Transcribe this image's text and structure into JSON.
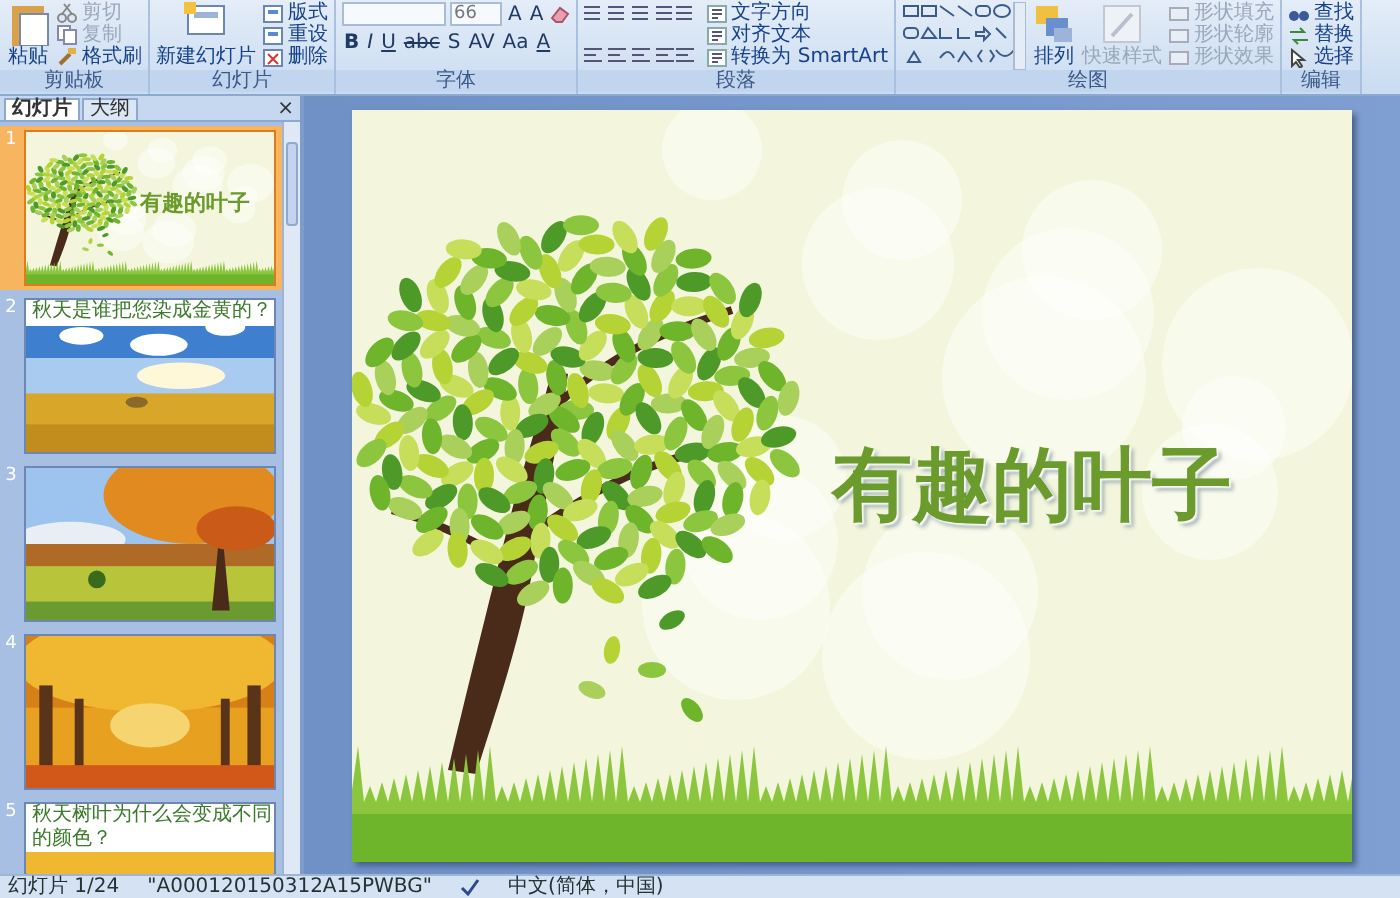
{
  "ribbon": {
    "groups": [
      {
        "label": "剪贴板",
        "controls": [
          {
            "kind": "large",
            "label": "粘贴",
            "disabled": false
          },
          {
            "kind": "small",
            "label": "剪切",
            "disabled": true
          },
          {
            "kind": "small",
            "label": "复制",
            "disabled": true
          },
          {
            "kind": "small",
            "label": "格式刷",
            "disabled": false
          }
        ]
      },
      {
        "label": "幻灯片",
        "controls": [
          {
            "kind": "large",
            "label": "新建幻灯片",
            "disabled": false
          },
          {
            "kind": "small",
            "label": "版式",
            "disabled": false
          },
          {
            "kind": "small",
            "label": "重设",
            "disabled": false
          },
          {
            "kind": "small",
            "label": "删除",
            "disabled": false
          }
        ]
      },
      {
        "label": "字体",
        "font_size": "66",
        "font_buttons": [
          "A",
          "A",
          "B",
          "I",
          "U",
          "abc",
          "S",
          "AV",
          "Aa",
          "A"
        ]
      },
      {
        "label": "段落",
        "controls": [
          {
            "kind": "small",
            "label": "文字方向",
            "disabled": false
          },
          {
            "kind": "small",
            "label": "对齐文本",
            "disabled": false
          },
          {
            "kind": "small",
            "label": "转换为 SmartArt",
            "disabled": false
          }
        ]
      },
      {
        "label": "绘图",
        "controls": [
          {
            "kind": "large",
            "label": "排列",
            "disabled": false
          },
          {
            "kind": "large",
            "label": "快速样式",
            "disabled": true
          },
          {
            "kind": "small",
            "label": "形状填充",
            "disabled": true
          },
          {
            "kind": "small",
            "label": "形状轮廓",
            "disabled": true
          },
          {
            "kind": "small",
            "label": "形状效果",
            "disabled": true
          }
        ]
      },
      {
        "label": "编辑",
        "controls": [
          {
            "kind": "small",
            "label": "查找",
            "disabled": false
          },
          {
            "kind": "small",
            "label": "替换",
            "disabled": false
          },
          {
            "kind": "small",
            "label": "选择",
            "disabled": false
          }
        ]
      }
    ]
  },
  "panel": {
    "tabs": [
      {
        "label": "幻灯片",
        "selected": true
      },
      {
        "label": "大纲",
        "selected": false
      }
    ],
    "close": "×",
    "slides": [
      {
        "number": "1",
        "kind": "title",
        "title": "有趣的叶子",
        "selected": true
      },
      {
        "number": "2",
        "kind": "captioned",
        "caption": "秋天是谁把您染成金黄的？",
        "selected": false
      },
      {
        "number": "3",
        "selected": false
      },
      {
        "number": "4",
        "selected": false
      },
      {
        "number": "5",
        "kind": "captioned",
        "caption": "秋天树叶为什么会变成不同的颜色？",
        "selected": false
      }
    ]
  },
  "slide": {
    "title": "有趣的叶子"
  },
  "status_bar": {
    "slide": "幻灯片 1/24",
    "theme": "\"A000120150312A15PWBG\"",
    "language": "中文(简体，中国)"
  }
}
